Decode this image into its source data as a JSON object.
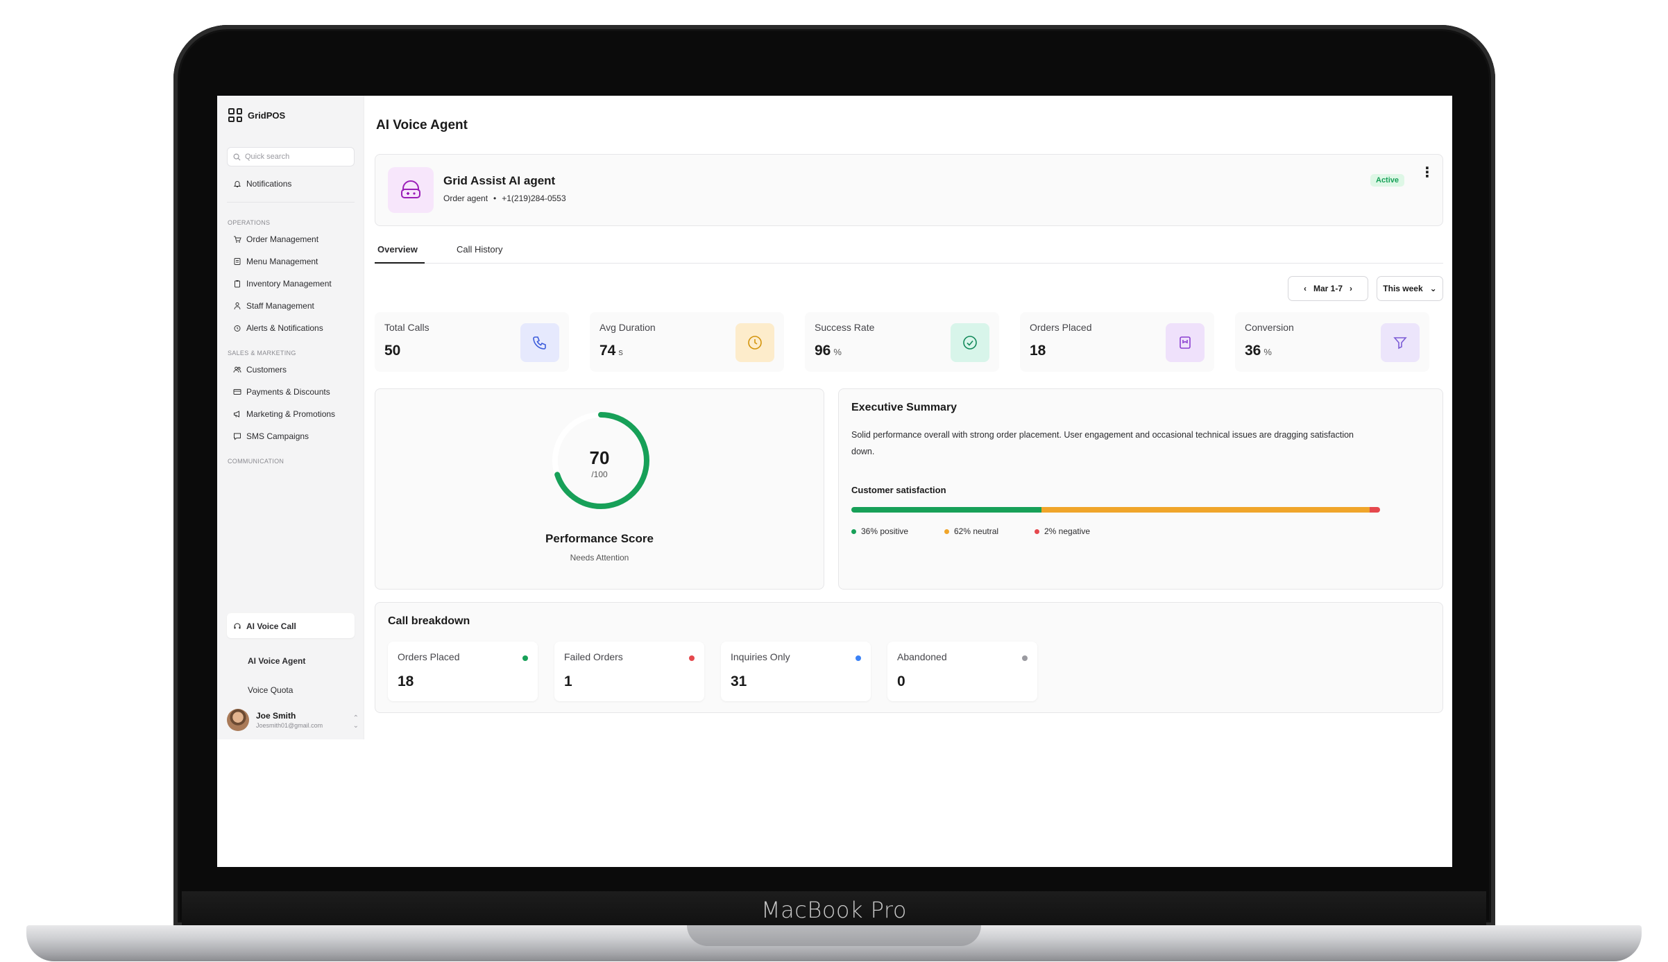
{
  "device": {
    "label": "MacBook Pro"
  },
  "brand": {
    "name": "GridPOS"
  },
  "sidebar": {
    "search_placeholder": "Quick search",
    "notifications_label": "Notifications",
    "sections": {
      "operations": "OPERATIONS",
      "sales": "SALES & MARKETING",
      "communication": "COMMUNICATION"
    },
    "items": {
      "order_management": "Order Management",
      "menu_management": "Menu Management",
      "inventory_management": "Inventory Management",
      "staff_management": "Staff Management",
      "alerts_notifications": "Alerts & Notifications",
      "customers": "Customers",
      "payments_discounts": "Payments & Discounts",
      "marketing_promotions": "Marketing & Promotions",
      "sms_campaigns": "SMS Campaigns",
      "ai_voice_call": "AI Voice Call",
      "ai_voice_agent": "AI Voice Agent",
      "voice_quota": "Voice Quota"
    },
    "user": {
      "name": "Joe Smith",
      "email": "Joesmith01@gmail.com"
    }
  },
  "page": {
    "title": "AI Voice Agent"
  },
  "agent": {
    "name": "Grid Assist AI agent",
    "role": "Order agent",
    "separator": "•",
    "phone": "+1(219)284-0553",
    "status": "Active"
  },
  "tabs": {
    "overview": "Overview",
    "call_history": "Call History"
  },
  "filters": {
    "date_range": "Mar 1-7",
    "period": "This week"
  },
  "stats": [
    {
      "label": "Total Calls",
      "value": "50",
      "unit": ""
    },
    {
      "label": "Avg Duration",
      "value": "74",
      "unit": "s"
    },
    {
      "label": "Success Rate",
      "value": "96",
      "unit": "%"
    },
    {
      "label": "Orders Placed",
      "value": "18",
      "unit": ""
    },
    {
      "label": "Conversion",
      "value": "36",
      "unit": "%"
    }
  ],
  "performance": {
    "score": "70",
    "max": "/100",
    "score_fraction": 0.7,
    "title": "Performance Score",
    "status": "Needs Attention"
  },
  "executive_summary": {
    "title": "Executive Summary",
    "text": "Solid performance overall with strong order placement. User engagement and occasional technical issues are dragging satisfaction down.",
    "satisfaction_title": "Customer satisfaction",
    "satisfaction": [
      {
        "label": "36% positive",
        "percent": 36,
        "color": "#17a058"
      },
      {
        "label": "62% neutral",
        "percent": 62,
        "color": "#f0a52a"
      },
      {
        "label": "2% negative",
        "percent": 2,
        "color": "#e5484d"
      }
    ]
  },
  "call_breakdown": {
    "title": "Call breakdown",
    "items": [
      {
        "label": "Orders Placed",
        "value": "18",
        "color": "#17a058"
      },
      {
        "label": "Failed Orders",
        "value": "1",
        "color": "#e5484d"
      },
      {
        "label": "Inquiries Only",
        "value": "31",
        "color": "#3b82f6"
      },
      {
        "label": "Abandoned",
        "value": "0",
        "color": "#9a9aa0"
      }
    ]
  }
}
